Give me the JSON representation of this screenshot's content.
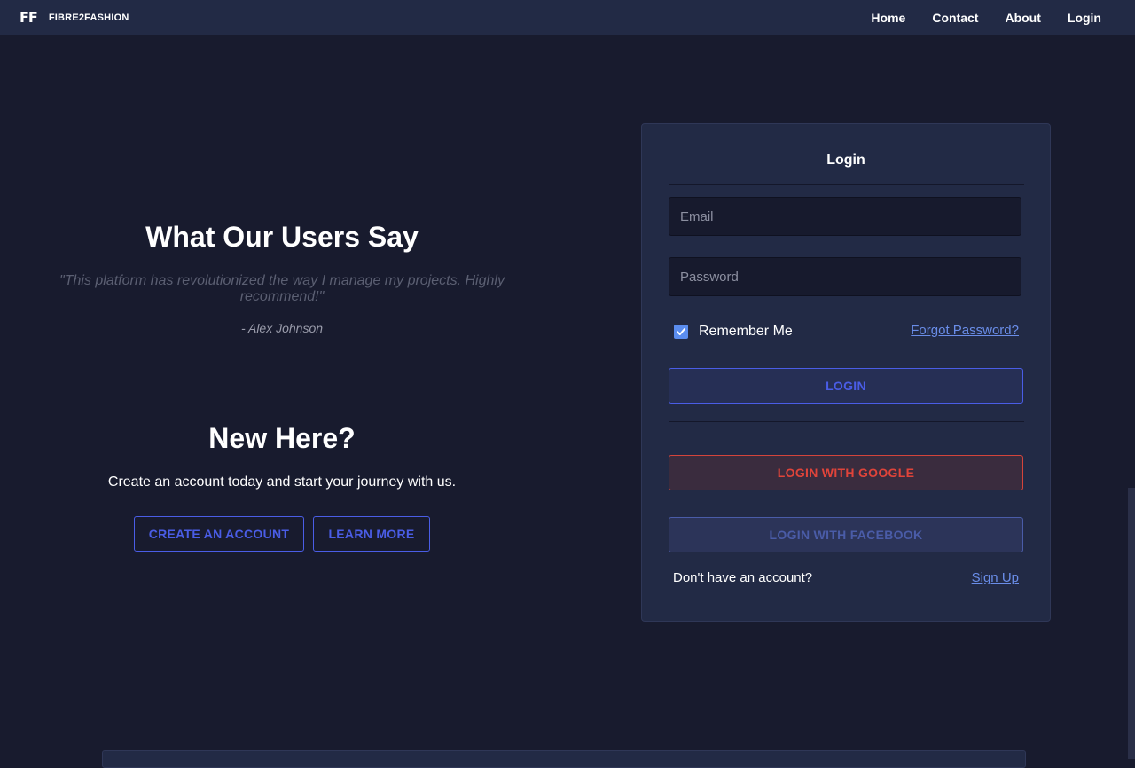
{
  "navbar": {
    "logo_mark": "FF",
    "logo_text": "FIBRE2FASHION",
    "links": [
      "Home",
      "Contact",
      "About",
      "Login"
    ]
  },
  "testimonial": {
    "title": "What Our Users Say",
    "quote": "\"This platform has revolutionized the way I manage my projects. Highly recommend!\"",
    "author": "- Alex Johnson"
  },
  "cta": {
    "title": "New Here?",
    "subtitle": "Create an account today and start your journey with us.",
    "create_label": "CREATE AN ACCOUNT",
    "learn_label": "LEARN MORE"
  },
  "login_card": {
    "title": "Login",
    "email_placeholder": "Email",
    "password_placeholder": "Password",
    "remember_label": "Remember Me",
    "remember_checked": true,
    "forgot_label": "Forgot Password?",
    "login_label": "LOGIN",
    "google_label": "LOGIN WITH GOOGLE",
    "facebook_label": "LOGIN WITH FACEBOOK",
    "no_account_text": "Don't have an account?",
    "signup_label": "Sign Up"
  },
  "colors": {
    "background": "#181b2e",
    "panel": "#222a45",
    "accent": "#4a5de6",
    "google": "#e0443a",
    "link": "#6a8de8"
  }
}
